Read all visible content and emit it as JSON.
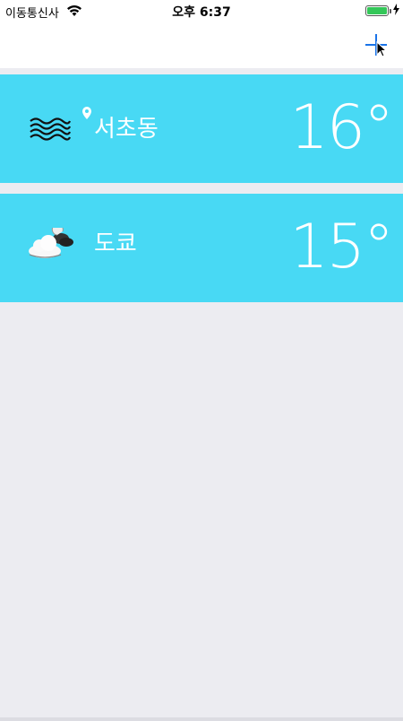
{
  "status_bar": {
    "carrier": "이동통신사",
    "time": "오후 6:37",
    "battery_level": 1.0,
    "icons": [
      "wifi-icon",
      "battery-icon",
      "charging-bolt-icon"
    ]
  },
  "nav": {
    "add_icon": "plus-icon",
    "accent_color": "#1a73e8"
  },
  "locations": [
    {
      "city": "서초동",
      "temperature": "16°",
      "weather_icon": "haze-icon",
      "current_location": true
    },
    {
      "city": "도쿄",
      "temperature": "15°",
      "weather_icon": "cloudy-night-icon",
      "current_location": false
    }
  ],
  "colors": {
    "row_background": "#48d9f4",
    "page_background": "#ececf1"
  }
}
